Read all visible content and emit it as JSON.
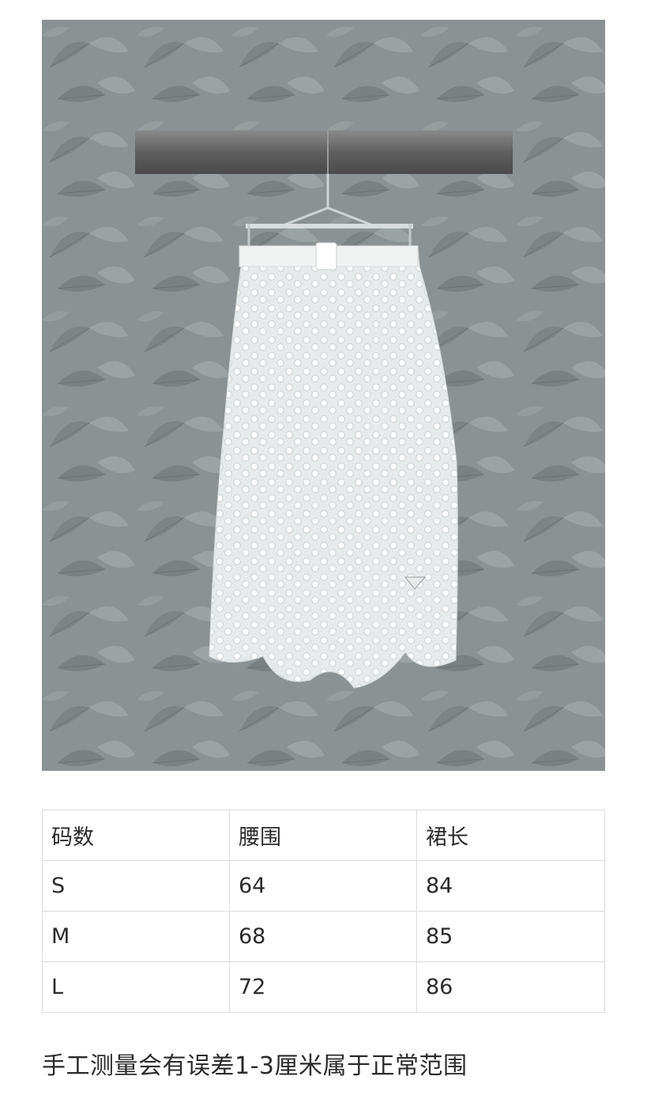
{
  "size_table": {
    "headers": [
      "码数",
      "腰围",
      "裙长"
    ],
    "rows": [
      [
        "S",
        "64",
        "84"
      ],
      [
        "M",
        "68",
        "85"
      ],
      [
        "L",
        "72",
        "86"
      ]
    ]
  },
  "note": "手工测量会有误差1-3厘米属于正常范围",
  "colors": {
    "wallpaper": "#8f9596",
    "skirt": "#e9ecec",
    "rail": "#6e6e6e"
  }
}
